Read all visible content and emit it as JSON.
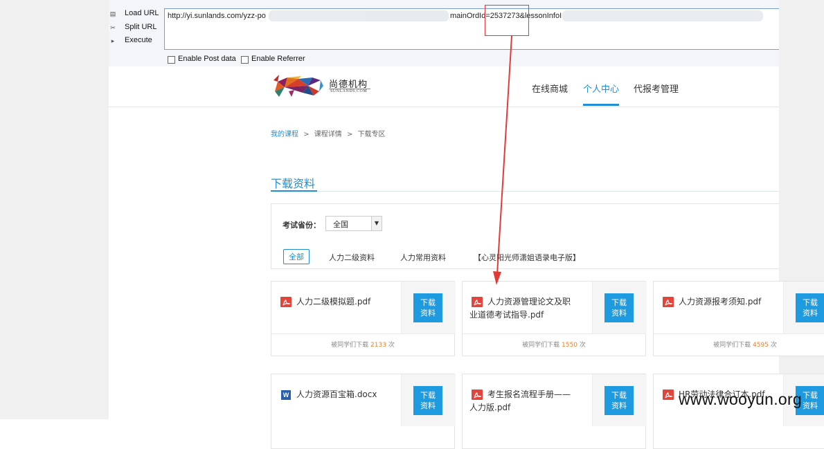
{
  "hackbar": {
    "buttons": [
      {
        "label": "Load URL",
        "icon": "load-url-icon"
      },
      {
        "label": "Split URL",
        "icon": "split-url-icon"
      },
      {
        "label": "Execute",
        "icon": "execute-icon"
      }
    ],
    "url_start": "http://yi.sunlands.com/yzz-po",
    "url_param": "mainOrdId=2537273&lessonInfoI",
    "checkboxes": [
      {
        "label": "Enable Post data",
        "checked": false
      },
      {
        "label": "Enable Referrer",
        "checked": false
      }
    ]
  },
  "site": {
    "logo_cn": "尚德机构",
    "logo_en": "SUNLANDS.COM",
    "nav": [
      {
        "label": "在线商城",
        "active": false
      },
      {
        "label": "个人中心",
        "active": true
      },
      {
        "label": "代报考管理",
        "active": false
      }
    ],
    "accent": "#1e8fd6"
  },
  "breadcrumb": {
    "items": [
      "我的课程",
      "课程详情",
      "下载专区"
    ],
    "separator": ">"
  },
  "section_title": "下载资料",
  "filter": {
    "province_label": "考试省份：",
    "province_value": "全国",
    "categories": [
      "全部",
      "人力二级资料",
      "人力常用资料",
      "【心灵阳光师潇姐语录电子版】"
    ]
  },
  "cards": [
    {
      "file": "人力二级模拟题.pdf",
      "type": "pdf-icon",
      "button": "下载\n资料",
      "count_prefix": "被同学们下载",
      "count": "2133",
      "count_suffix": "次"
    },
    {
      "file": "人力资源管理论文及职业道德考试指导.pdf",
      "type": "pdf-icon",
      "button": "下载\n资料",
      "count_prefix": "被同学们下载",
      "count": "1550",
      "count_suffix": "次"
    },
    {
      "file": "人力资源报考须知.pdf",
      "type": "pdf-icon",
      "button": "下载\n资料",
      "count_prefix": "被同学们下载",
      "count": "4595",
      "count_suffix": "次"
    },
    {
      "file": "人力资源百宝箱.docx",
      "type": "word-icon",
      "button": "下载\n资料"
    },
    {
      "file": "考生报名流程手册——人力版.pdf",
      "type": "pdf-icon",
      "button": "下载\n资料"
    },
    {
      "file": "HR劳动法律合订本.pdf",
      "type": "pdf-icon",
      "button": "下载\n资料"
    }
  ],
  "watermark": "www.wooyun.org"
}
